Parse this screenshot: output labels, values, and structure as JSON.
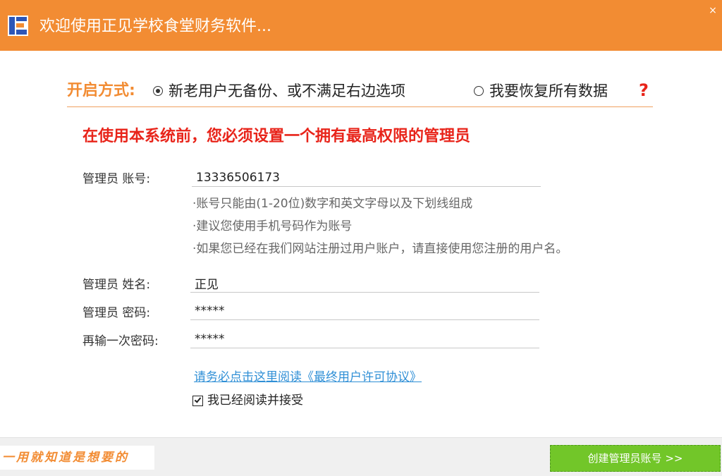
{
  "window": {
    "title": "欢迎使用正见学校食堂财务软件...",
    "close_glyph": "×",
    "colors": {
      "titlebar": "#f28c33",
      "accent_red": "#e8241a",
      "link": "#2f8fd6",
      "button_green": "#72c629"
    }
  },
  "mode": {
    "label": "开启方式:",
    "options": [
      {
        "label": "新老用户无备份、或不满足右边选项",
        "selected": true
      },
      {
        "label": "我要恢复所有数据",
        "selected": false
      }
    ],
    "help_glyph": "?"
  },
  "warning": "在使用本系统前，您必须设置一个拥有最高权限的管理员",
  "form": {
    "account_label": "管理员  账号:",
    "account_value": "13336506173",
    "hints": [
      "·账号只能由(1-20位)数字和英文字母以及下划线组成",
      "·建议您使用手机号码作为账号",
      "·如果您已经在我们网站注册过用户账户，请直接使用您注册的用户名。"
    ],
    "name_label": "管理员  姓名:",
    "name_value": "正见",
    "password_label": "管理员  密码:",
    "password_value": "*****",
    "confirm_label": "再输一次密码:",
    "confirm_value": "*****"
  },
  "eula": {
    "link_text": "请务必点击这里阅读《最终用户许可协议》",
    "agree_label": "我已经阅读并接受",
    "agreed": true
  },
  "footer": {
    "slogan": "一用就知道是想要的",
    "create_button": "创建管理员账号 >>"
  }
}
